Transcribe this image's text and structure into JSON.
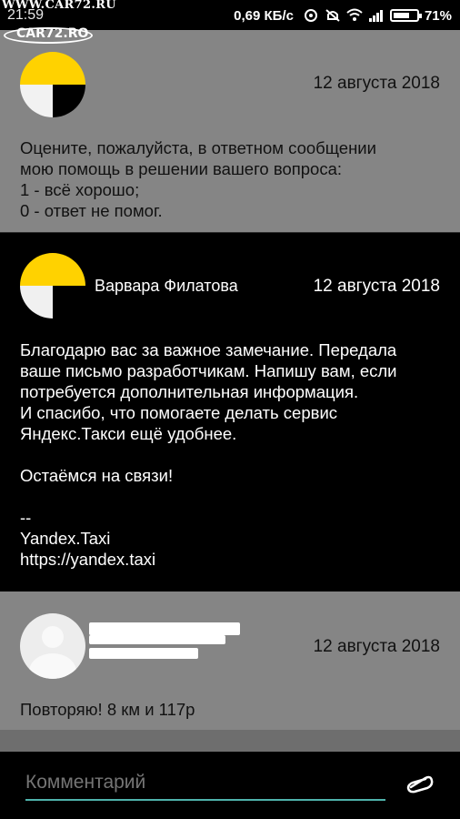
{
  "status_bar": {
    "time": "21:59",
    "speed": "0,69 КБ/с",
    "battery": "71%",
    "battery_level": 0.71
  },
  "watermark": {
    "top_text": "WWW.CAR72.RU",
    "logo_text": "CAR72.RO"
  },
  "messages": [
    {
      "author": "",
      "date": "12 августа 2018",
      "text": "Оцените, пожалуйста, в ответном сообщении\nмою помощь в решении вашего вопроса:\n1 - всё хорошо;\n0 - ответ не помог."
    },
    {
      "author": "Варвара Филатова",
      "date": "12 августа 2018",
      "text": "Благодарю вас за важное замечание. Передала\nваше письмо разработчикам. Напишу вам, если\nпотребуется дополнительная информация.\nИ спасибо, что помогаете делать сервис\nЯндекс.Такси ещё удобнее.\n\nОстаёмся на связи!\n\n--\nYandex.Taxi\nhttps://yandex.taxi"
    },
    {
      "author": "",
      "date": "12 августа 2018",
      "text": "Повторяю! 8 км и 117р"
    }
  ],
  "comment": {
    "placeholder": "Комментарий"
  }
}
